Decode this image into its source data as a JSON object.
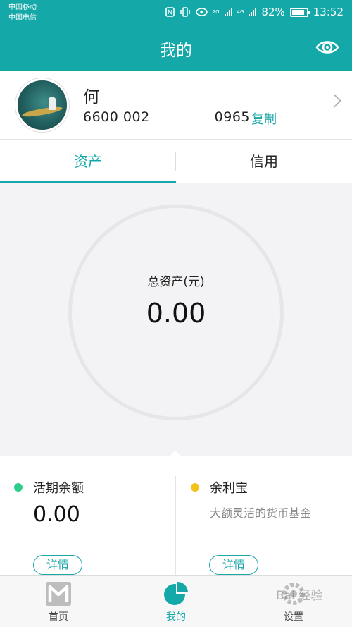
{
  "status_bar": {
    "carrier_1": "中国移动",
    "carrier_2": "中国电信",
    "network_1": "2G",
    "network_2": "4G",
    "battery": "82%",
    "time": "13:52"
  },
  "header": {
    "title": "我的",
    "visibility_icon": "eye-icon"
  },
  "profile": {
    "name": "何",
    "account_number": "6600 002",
    "account_number_tail": "0965",
    "copy_label": "复制",
    "navigate_icon": "chevron-right-icon"
  },
  "tabs": [
    {
      "label": "资产",
      "active": true
    },
    {
      "label": "信用",
      "active": false
    }
  ],
  "assets": {
    "total_label": "总资产(元)",
    "total_value": "0.00"
  },
  "cards": [
    {
      "title": "活期余额",
      "value": "0.00",
      "dot_color": "#2ecc8e",
      "detail_label": "详情"
    },
    {
      "title": "余利宝",
      "description": "大额灵活的货币基金",
      "dot_color": "#f2c21b",
      "detail_label": "详情"
    }
  ],
  "bottom_nav": [
    {
      "label": "首页",
      "icon": "home-m-icon",
      "active": false
    },
    {
      "label": "我的",
      "icon": "pie-chart-icon",
      "active": true
    },
    {
      "label": "设置",
      "icon": "settings-icon",
      "active": false
    }
  ],
  "watermark": "Bai 经验",
  "colors": {
    "accent": "#15a8a9",
    "background": "#f3f3f5"
  }
}
